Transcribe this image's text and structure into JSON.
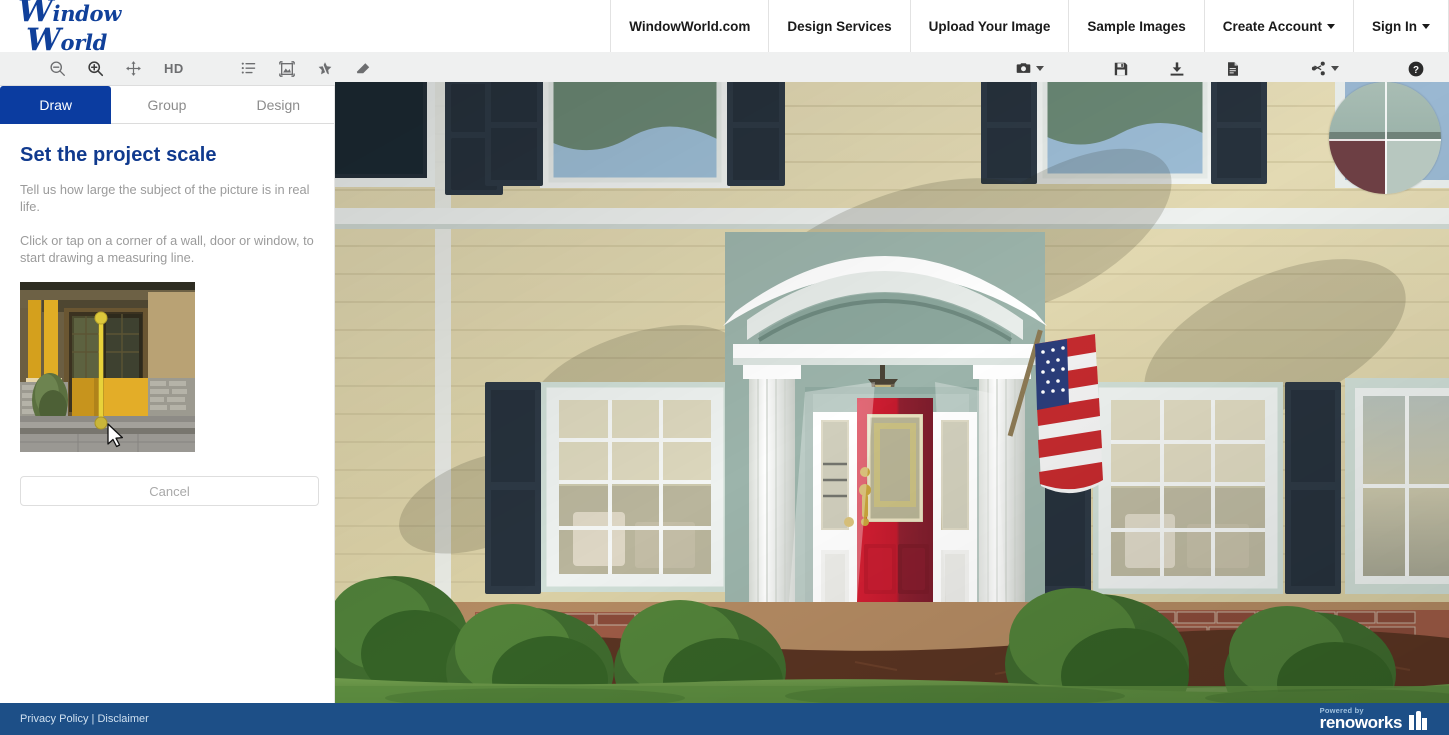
{
  "header": {
    "logo": {
      "word1_first": "W",
      "word1_rest": "indow",
      "word2_first": "W",
      "word2_rest": "orld"
    },
    "nav": [
      {
        "label": "WindowWorld.com",
        "has_caret": false
      },
      {
        "label": "Design Services",
        "has_caret": false
      },
      {
        "label": "Upload Your Image",
        "has_caret": false
      },
      {
        "label": "Sample Images",
        "has_caret": false
      },
      {
        "label": "Create Account",
        "has_caret": true
      },
      {
        "label": "Sign In",
        "has_caret": true
      }
    ]
  },
  "toolbar": {
    "left": [
      {
        "name": "zoom-out-icon",
        "label": ""
      },
      {
        "name": "zoom-in-icon",
        "label": ""
      },
      {
        "name": "pan-move-icon",
        "label": ""
      },
      {
        "name": "hd-toggle",
        "label": "HD"
      },
      {
        "name": "list-icon",
        "label": ""
      },
      {
        "name": "fit-image-icon",
        "label": ""
      },
      {
        "name": "magic-wand-icon",
        "label": ""
      },
      {
        "name": "eraser-icon",
        "label": ""
      }
    ],
    "right": [
      {
        "name": "camera-icon",
        "label": ""
      },
      {
        "name": "save-icon",
        "label": ""
      },
      {
        "name": "download-icon",
        "label": ""
      },
      {
        "name": "document-icon",
        "label": ""
      },
      {
        "name": "share-icon",
        "label": ""
      },
      {
        "name": "help-icon",
        "label": ""
      }
    ]
  },
  "sidebar": {
    "tabs": [
      {
        "label": "Draw",
        "active": true
      },
      {
        "label": "Group",
        "active": false
      },
      {
        "label": "Design",
        "active": false
      }
    ],
    "title": "Set the project scale",
    "paragraph1": "Tell us how large the subject of the picture is in real life.",
    "paragraph2": "Click or tap on a corner of a wall, door or window, to start drawing a measuring line.",
    "cancel_label": "Cancel",
    "thumbnail_alt": "example-measuring-line-on-door"
  },
  "canvas": {
    "image_alt": "house-exterior-with-red-front-door",
    "magnifier_alt": "zoom-loupe-crosshair"
  },
  "footer": {
    "privacy": "Privacy Policy",
    "separator": "|",
    "disclaimer": "Disclaimer",
    "powered_small": "Powered by",
    "powered_big": "renoworks"
  },
  "colors": {
    "brand_blue": "#10409a",
    "tab_active": "#0b3ca0",
    "title_blue": "#103a8e",
    "footer_blue": "#1d4f87",
    "toolbar_bg": "#eff0f0",
    "muted_text": "#9b9b9b",
    "measure_line": "#e8d23a"
  }
}
